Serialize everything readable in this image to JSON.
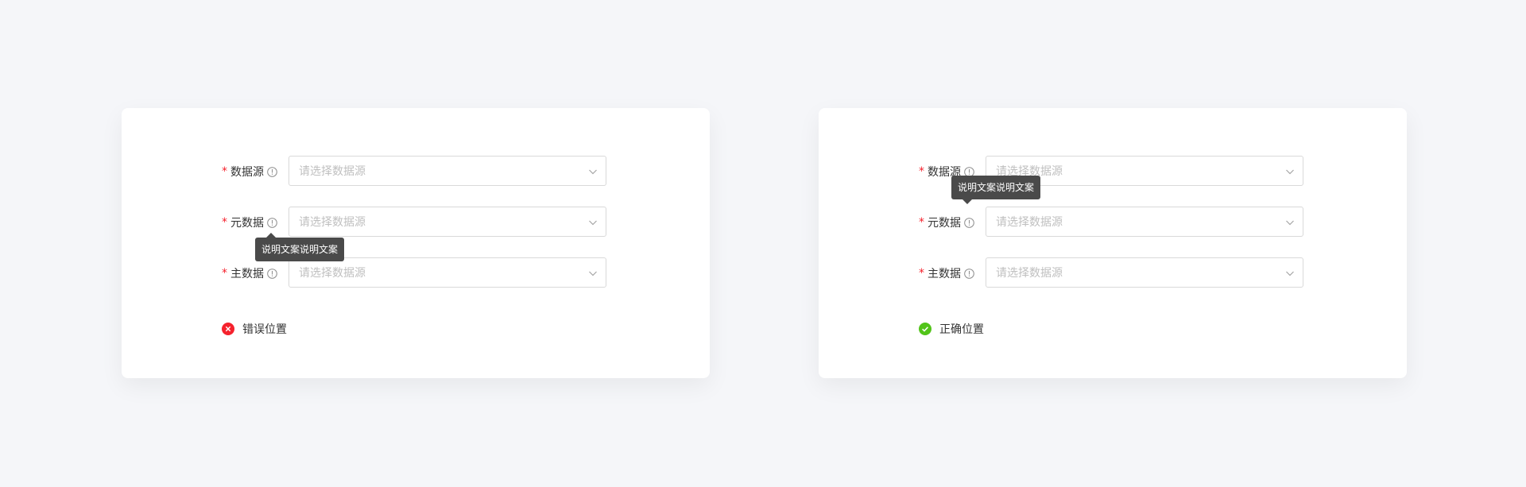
{
  "left_panel": {
    "fields": [
      {
        "label": "数据源",
        "placeholder": "请选择数据源"
      },
      {
        "label": "元数据",
        "placeholder": "请选择数据源"
      },
      {
        "label": "主数据",
        "placeholder": "请选择数据源"
      }
    ],
    "required_mark": "*",
    "tooltip": "说明文案说明文案",
    "result_label": "错误位置",
    "result_icon": "error-circle-icon",
    "result_color": "#f5222d"
  },
  "right_panel": {
    "fields": [
      {
        "label": "数据源",
        "placeholder": "请选择数据源"
      },
      {
        "label": "元数据",
        "placeholder": "请选择数据源"
      },
      {
        "label": "主数据",
        "placeholder": "请选择数据源"
      }
    ],
    "required_mark": "*",
    "tooltip": "说明文案说明文案",
    "result_label": "正确位置",
    "result_icon": "success-circle-icon",
    "result_color": "#52c41a"
  }
}
